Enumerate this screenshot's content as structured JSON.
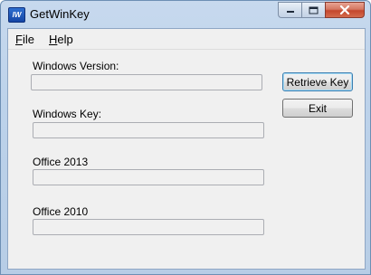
{
  "window": {
    "title": "GetWinKey",
    "app_icon_text": "IW",
    "caption_buttons": [
      "minimize-icon",
      "maximize-icon",
      "close-icon"
    ]
  },
  "menu": {
    "file": {
      "accel": "F",
      "rest": "ile"
    },
    "help": {
      "accel": "H",
      "rest": "elp"
    }
  },
  "fields": {
    "windows_version": {
      "label": "Windows Version:",
      "value": ""
    },
    "windows_key": {
      "label": "Windows Key:",
      "value": ""
    },
    "office_2013": {
      "label": "Office 2013",
      "value": ""
    },
    "office_2010": {
      "label": "Office 2010",
      "value": ""
    }
  },
  "buttons": {
    "retrieve": "Retrieve Key",
    "exit": "Exit"
  },
  "colors": {
    "title_bar": "#bcd2ea",
    "client_bg": "#f0f0f0",
    "close_button": "#c4472d"
  }
}
